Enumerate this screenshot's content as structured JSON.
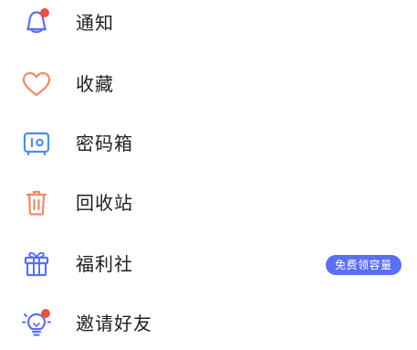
{
  "menu": {
    "items": [
      {
        "label": "通知",
        "icon": "bell-icon",
        "has_dot": true
      },
      {
        "label": "收藏",
        "icon": "heart-icon"
      },
      {
        "label": "密码箱",
        "icon": "safe-box-icon"
      },
      {
        "label": "回收站",
        "icon": "trash-icon"
      },
      {
        "label": "福利社",
        "icon": "gift-icon",
        "badge": "免费领容量"
      },
      {
        "label": "邀请好友",
        "icon": "lightbulb-icon",
        "has_dot": true
      }
    ]
  },
  "colors": {
    "icon_blue": "#5b6ff4",
    "icon_orange": "#ef8a6a",
    "notification_dot": "#e8533f",
    "badge_bg": "#5b6ff4"
  }
}
